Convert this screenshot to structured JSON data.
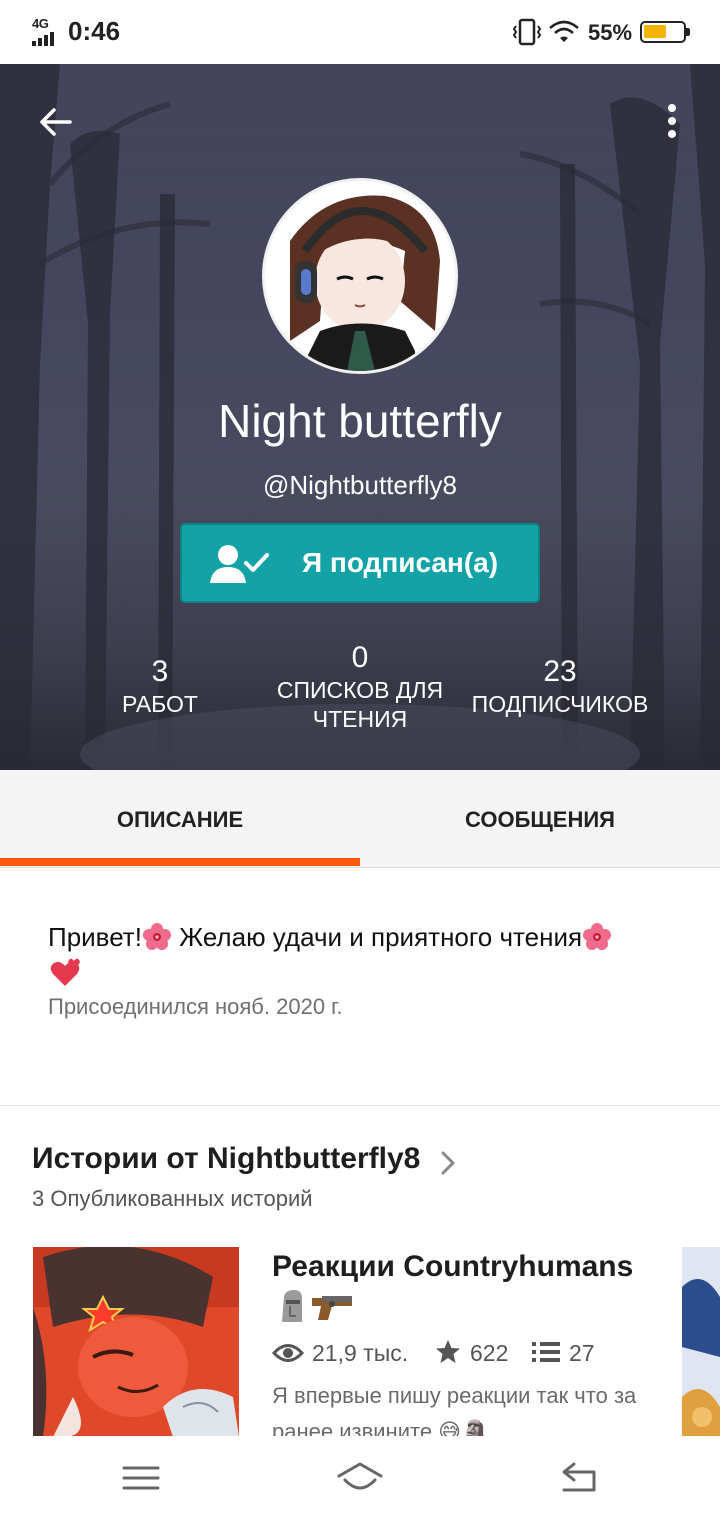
{
  "status_bar": {
    "network": "4G",
    "time": "0:46",
    "battery_percent": "55%",
    "battery_level": 0.55,
    "icons": [
      "signal-icon",
      "vibrate-icon",
      "wifi-icon",
      "battery-icon"
    ]
  },
  "header": {
    "back_icon": "arrow-left-icon",
    "more_icon": "more-vertical-icon",
    "name": "Night butterfly",
    "handle": "@Nightbutterfly8",
    "follow_button": {
      "label": "Я подписан(а)",
      "icon": "user-check-icon",
      "color": "#13a3a6"
    },
    "stats": [
      {
        "value": "3",
        "label": "РАБОТ"
      },
      {
        "value": "0",
        "label": "СПИСКОВ ДЛЯ ЧТЕНИЯ"
      },
      {
        "value": "23",
        "label": "ПОДПИСЧИКОВ"
      }
    ]
  },
  "tabs": [
    {
      "label": "ОПИСАНИЕ",
      "active": true
    },
    {
      "label": "СООБЩЕНИЯ",
      "active": false
    }
  ],
  "accent_color": "#ff5a0a",
  "about": {
    "bio": "Привет!🌺 Желаю удачи и приятного чтения🌺💕",
    "bio_part1": "Привет!",
    "bio_part2": " Желаю удачи и приятного чтения",
    "joined": "Присоединился нояб. 2020 г."
  },
  "stories": {
    "title": "Истории от Nightbutterfly8",
    "count_text": "3 Опубликованных историй",
    "items": [
      {
        "title": "Реакции Countryhumans",
        "title_emojis": [
          "moai-icon",
          "pistol-icon"
        ],
        "reads": "21,9 тыс.",
        "votes": "622",
        "parts": "27",
        "description": "Я впервые пишу реакции так что за ранее извините 😅🗿"
      }
    ]
  },
  "nav": {
    "icons": [
      "menu-icon",
      "home-icon",
      "back-icon"
    ]
  }
}
